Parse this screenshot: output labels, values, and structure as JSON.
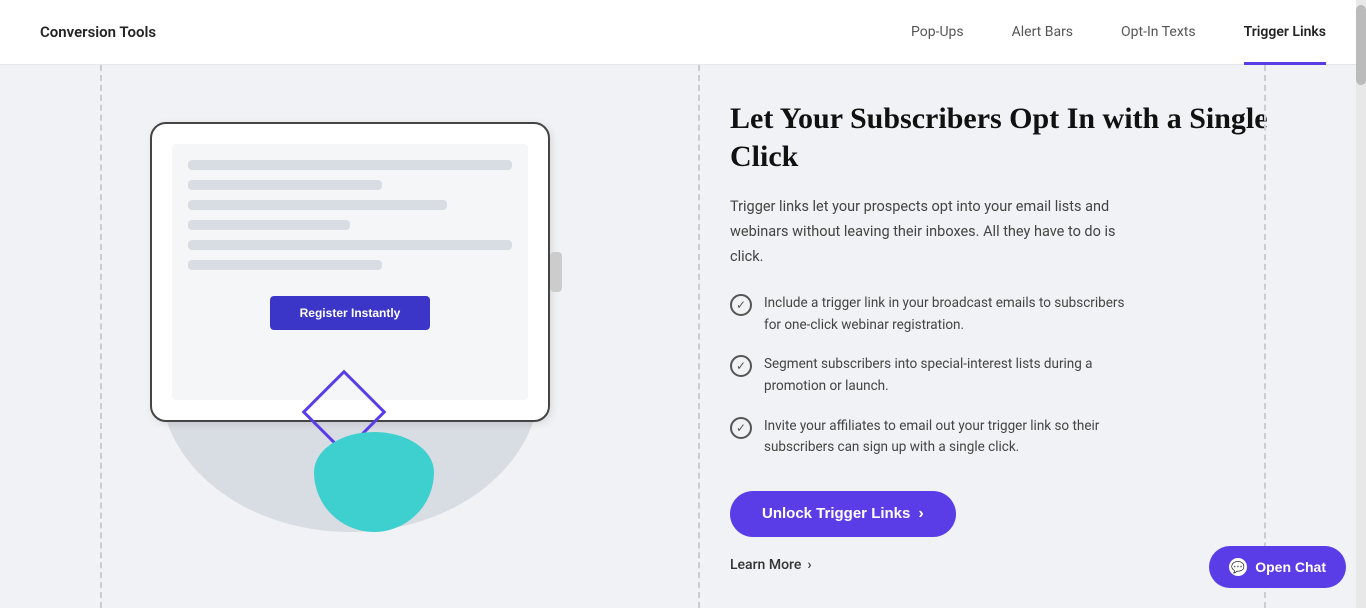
{
  "header": {
    "brand": "Conversion Tools",
    "nav": [
      {
        "id": "popups",
        "label": "Pop-Ups",
        "active": false
      },
      {
        "id": "alertbars",
        "label": "Alert Bars",
        "active": false
      },
      {
        "id": "optintexts",
        "label": "Opt-In Texts",
        "active": false
      },
      {
        "id": "triggerlinks",
        "label": "Trigger Links",
        "active": true
      }
    ]
  },
  "content": {
    "title": "Let Your Subscribers Opt In with a Single Click",
    "description": "Trigger links let your prospects opt into your email lists and webinars without leaving their inboxes. All they have to do is click.",
    "features": [
      {
        "id": "feature-1",
        "text": "Include a trigger link in your broadcast emails to subscribers for one-click webinar registration."
      },
      {
        "id": "feature-2",
        "text": "Segment subscribers into special-interest lists during a promotion or launch."
      },
      {
        "id": "feature-3",
        "text": "Invite your affiliates to email out your trigger link so their subscribers can sign up with a single click."
      }
    ],
    "cta_label": "Unlock Trigger Links",
    "learn_more_label": "Learn More",
    "tablet_button_label": "Register Instantly"
  },
  "chat": {
    "label": "Open Chat"
  }
}
